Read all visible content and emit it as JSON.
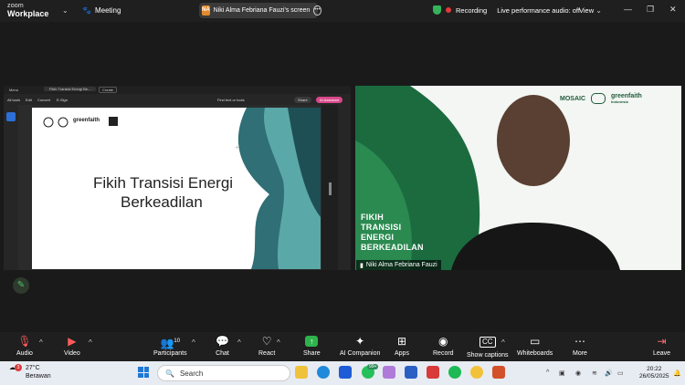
{
  "app": {
    "name_line1": "zoom",
    "name_line2": "Workplace"
  },
  "topbar": {
    "meeting_label": "Meeting",
    "share_pill": {
      "initials": "NA",
      "text": "Niki Alma Febriana Fauzi's screen"
    },
    "recording_label": "Recording",
    "live_audio_label": "Live performance audio: off",
    "view_label": "View"
  },
  "shared_app": {
    "menu_label": "Menu",
    "tab_title": "Fikih Transisi Energi Be...",
    "create_label": "Create",
    "tools": [
      "All tools",
      "Edit",
      "Convert",
      "E-Sign"
    ],
    "find_placeholder": "Find text or tools",
    "share_label": "Share",
    "ai_label": "AI Assistant"
  },
  "slide": {
    "title_line1": "Fikih Transisi Energi",
    "title_line2": "Berkeadilan",
    "logo_text": "greenfaith"
  },
  "video": {
    "caption_lines": [
      "FIKIH",
      "TRANSISI",
      "ENERGI",
      "BERKEADILAN"
    ],
    "logo1": "MOSAIC",
    "logo2": "greenfaith",
    "logo2_sub": "Indonesia",
    "participant_name": "Niki Alma Febriana Fauzi"
  },
  "toolbar": {
    "audio": "Audio",
    "video": "Video",
    "participants": "Participants",
    "participants_count": "10",
    "chat": "Chat",
    "react": "React",
    "share": "Share",
    "ai_companion": "AI Companion",
    "apps": "Apps",
    "record": "Record",
    "captions": "Show captions",
    "whiteboards": "Whiteboards",
    "more": "More",
    "leave": "Leave"
  },
  "taskbar": {
    "weather_badge": "3",
    "temp": "27°C",
    "condition": "Berawan",
    "search_label": "Search",
    "whatsapp_badge": "99+",
    "time": "20:22",
    "date": "26/05/2025"
  },
  "colors": {
    "accent_green": "#2eb34c",
    "record_red": "#e03a3a",
    "video_green": "#1b6b3f"
  }
}
